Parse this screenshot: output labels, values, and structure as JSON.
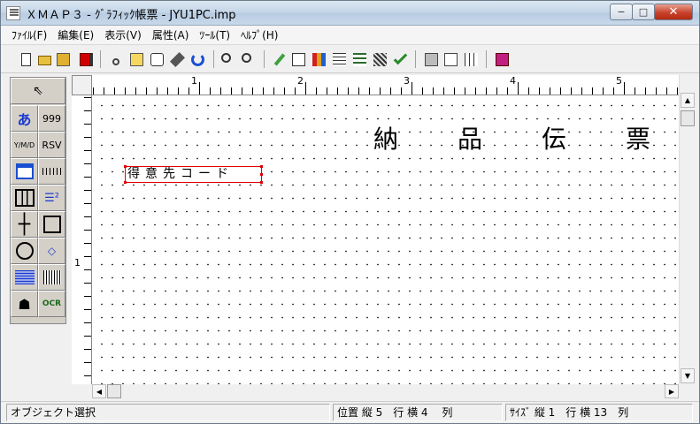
{
  "window": {
    "title": "ＸＭＡＰ３ - ｸﾞﾗﾌｨｯｸ帳票 - JYU1PC.imp",
    "minimize_label": "−",
    "maximize_label": "□",
    "close_label": "✕"
  },
  "menu": [
    {
      "label": "ﾌｧｲﾙ(F)"
    },
    {
      "label": "編集(E)"
    },
    {
      "label": "表示(V)"
    },
    {
      "label": "属性(A)"
    },
    {
      "label": "ﾂｰﾙ(T)"
    },
    {
      "label": "ﾍﾙﾌﾟ(H)"
    }
  ],
  "toolbar_icons": [
    "new-file-icon",
    "open-folder-icon",
    "save-icon",
    "red-stop-icon",
    "cut-icon",
    "copy-icon",
    "paste-icon",
    "eraser-icon",
    "undo-icon",
    "zoom-in-icon",
    "zoom-out-icon",
    "pencil-icon",
    "edit-field-icon",
    "color-pencils-icon",
    "edit-lines-icon",
    "edit-list-icon",
    "pattern-icon",
    "check-icon",
    "print-icon",
    "print-preview-icon",
    "grid-icon",
    "book-icon"
  ],
  "palette": {
    "pointer_icon": "arrow-pointer-icon",
    "text_label": "あ",
    "number_label": "999",
    "date_label": "Y/M/D",
    "rsv_label": "RSV",
    "ocr_label": "OCR"
  },
  "ruler": {
    "h_numbers": [
      "1",
      "2",
      "3",
      "4",
      "5"
    ],
    "v_numbers": [
      "1"
    ]
  },
  "document": {
    "heading": "納品伝票",
    "field_text": "得意先コード"
  },
  "status": {
    "mode": "オブジェクト選択",
    "position": "位置 縦 5　行 横 4　 列",
    "size": "ｻｲｽﾞ 縦 1　行 横 13　列"
  },
  "colors": {
    "selection_red": "#e00000",
    "palette_bg": "#d4d0c8"
  }
}
